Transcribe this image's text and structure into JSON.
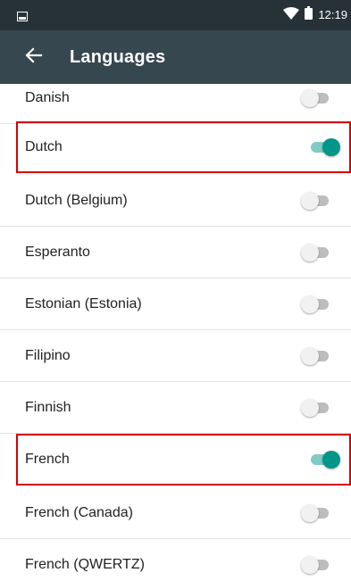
{
  "status_bar": {
    "time": "12:19",
    "left_icon": "notification-icon",
    "wifi_icon": "wifi-icon",
    "battery_icon": "battery-icon"
  },
  "toolbar": {
    "back_icon": "arrow-left-icon",
    "title": "Languages"
  },
  "colors": {
    "status_bar_bg": "#263238",
    "toolbar_bg": "#37474f",
    "toggle_on": "#009688",
    "highlight_border": "#d50000"
  },
  "languages": [
    {
      "label": "Danish",
      "enabled": false,
      "highlighted": false
    },
    {
      "label": "Dutch",
      "enabled": true,
      "highlighted": true
    },
    {
      "label": "Dutch (Belgium)",
      "enabled": false,
      "highlighted": false
    },
    {
      "label": "Esperanto",
      "enabled": false,
      "highlighted": false
    },
    {
      "label": "Estonian (Estonia)",
      "enabled": false,
      "highlighted": false
    },
    {
      "label": "Filipino",
      "enabled": false,
      "highlighted": false
    },
    {
      "label": "Finnish",
      "enabled": false,
      "highlighted": false
    },
    {
      "label": "French",
      "enabled": true,
      "highlighted": true
    },
    {
      "label": "French (Canada)",
      "enabled": false,
      "highlighted": false
    },
    {
      "label": "French (QWERTZ)",
      "enabled": false,
      "highlighted": false
    }
  ]
}
